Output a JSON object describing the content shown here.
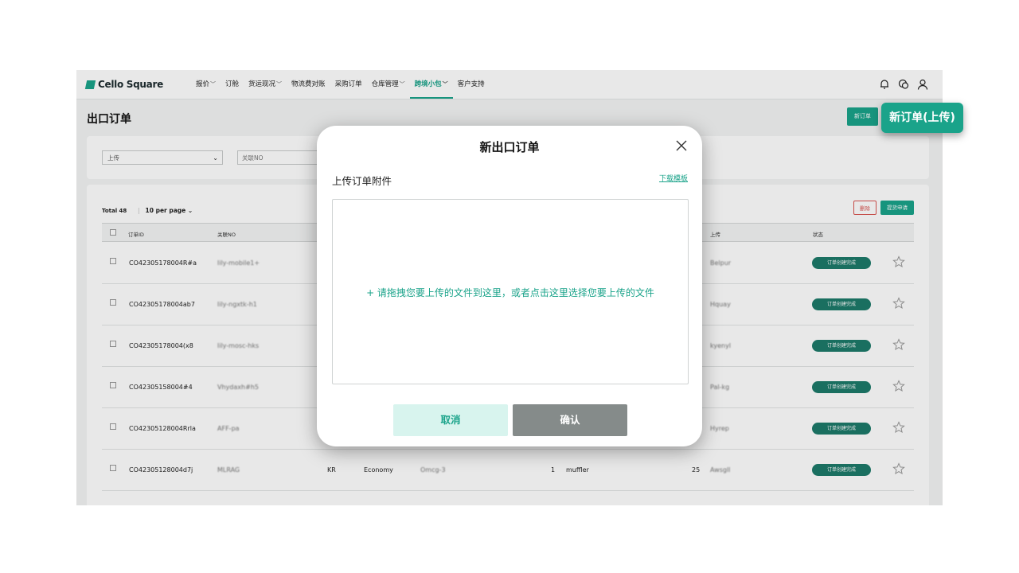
{
  "brand": {
    "name": "Cello Square"
  },
  "nav": {
    "items": [
      {
        "label": "报价",
        "has_dropdown": true
      },
      {
        "label": "订舱",
        "has_dropdown": false
      },
      {
        "label": "货运现况",
        "has_dropdown": true
      },
      {
        "label": "物流费对账",
        "has_dropdown": false
      },
      {
        "label": "采购订单",
        "has_dropdown": false
      },
      {
        "label": "仓库管理",
        "has_dropdown": true
      },
      {
        "label": "跨境小包",
        "has_dropdown": true,
        "active": true
      },
      {
        "label": "客户支持",
        "has_dropdown": false
      }
    ],
    "icons": [
      "bell-icon",
      "chat-icon",
      "user-icon"
    ]
  },
  "page": {
    "title": "出口订单",
    "new_order_label": "新订单",
    "new_order_upload_label": "新订单(上传)"
  },
  "filters": {
    "select_value": "上传",
    "ref_placeholder": "关联NO"
  },
  "list": {
    "total": "Total 48",
    "per_page": "10 per page",
    "delete_label": "删除",
    "submit_label": "提货申请",
    "headers": {
      "order_id": "订单ID",
      "ref_no": "关联NO",
      "upload": "上传",
      "status": "状态"
    },
    "rows": [
      {
        "order_id": "CO42305178004R#a",
        "ref_no": "lily-mobile1+",
        "country": "",
        "service": "",
        "code": "",
        "qty": "",
        "item": "",
        "weight": "",
        "upload": "Belpur",
        "status": "订单创建完成"
      },
      {
        "order_id": "CO42305178004ab7",
        "ref_no": "lily-ngxtk-h1",
        "country": "",
        "service": "",
        "code": "",
        "qty": "",
        "item": "",
        "weight": "",
        "upload": "Hquay",
        "status": "订单创建完成"
      },
      {
        "order_id": "CO42305178004(x8",
        "ref_no": "lily-mosc-hks",
        "country": "",
        "service": "",
        "code": "",
        "qty": "",
        "item": "",
        "weight": "",
        "upload": "kyenyl",
        "status": "订单创建完成"
      },
      {
        "order_id": "CO42305158004#4",
        "ref_no": "Vhydaxh#h5",
        "country": "",
        "service": "",
        "code": "",
        "qty": "",
        "item": "",
        "weight": "",
        "upload": "Pal-kg",
        "status": "订单创建完成"
      },
      {
        "order_id": "CO42305128004Rrla",
        "ref_no": "AFF-pa",
        "country": "",
        "service": "",
        "code": "",
        "qty": "",
        "item": "",
        "weight": "",
        "upload": "Hyrep",
        "status": "订单创建完成"
      },
      {
        "order_id": "CO42305128004d7j",
        "ref_no": "MLRAG",
        "country": "KR",
        "service": "Economy",
        "code": "Omcg-3",
        "qty": "1",
        "item": "muffler",
        "weight": "25",
        "upload": "Awsgll",
        "status": "订单创建完成"
      }
    ]
  },
  "modal": {
    "title": "新出口订单",
    "subtitle": "上传订单附件",
    "download_template": "下载模板",
    "drop_text": "+ 请拖拽您要上传的文件到这里，或者点击这里选择您要上传的文件",
    "cancel": "取消",
    "confirm": "确认"
  },
  "colors": {
    "accent": "#1aa38a",
    "status_badge": "#1d7a6a",
    "danger": "#d9534f",
    "confirm_disabled": "#858b8a",
    "cancel_bg": "#d8f4ee"
  }
}
